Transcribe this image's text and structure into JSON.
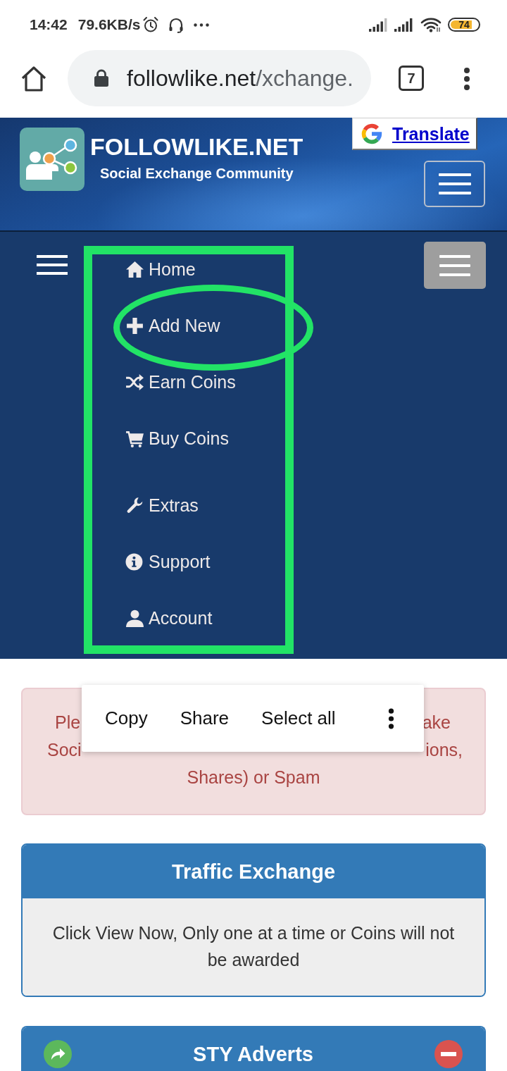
{
  "status_bar": {
    "time": "14:42",
    "network_speed": "79.6KB/s",
    "battery": "74"
  },
  "browser_toolbar": {
    "url_host": "followlike.net",
    "url_path": "/xchange.",
    "tab_count": "7"
  },
  "site_header": {
    "site_name": "FOLLOWLIKE.NET",
    "tagline": "Social Exchange Community",
    "translate_link": "Translate"
  },
  "nav_menu": {
    "items": [
      {
        "kind": "home",
        "label": "Home"
      },
      {
        "kind": "add",
        "label": "Add New"
      },
      {
        "kind": "shuffle",
        "label": "Earn Coins"
      },
      {
        "kind": "cart",
        "label": "Buy Coins"
      },
      {
        "kind": "wrench",
        "label": "Extras"
      },
      {
        "kind": "info",
        "label": "Support"
      },
      {
        "kind": "user",
        "label": "Account"
      }
    ]
  },
  "annotations": [
    {
      "kind": "rectangle"
    },
    {
      "kind": "ellipse"
    }
  ],
  "alert": {
    "lines": [
      [
        "Ple",
        "ake"
      ],
      [
        "Soci",
        "ions,"
      ],
      [
        "Shares) or Spam"
      ]
    ]
  },
  "selection_menu": {
    "items": [
      "Copy",
      "Share",
      "Select all"
    ]
  },
  "panels": [
    {
      "kind": "notice",
      "title": "Traffic Exchange",
      "body": "Click View Now, Only one at a time or Coins will not be awarded"
    },
    {
      "kind": "advert",
      "title": "STY Adverts"
    }
  ]
}
